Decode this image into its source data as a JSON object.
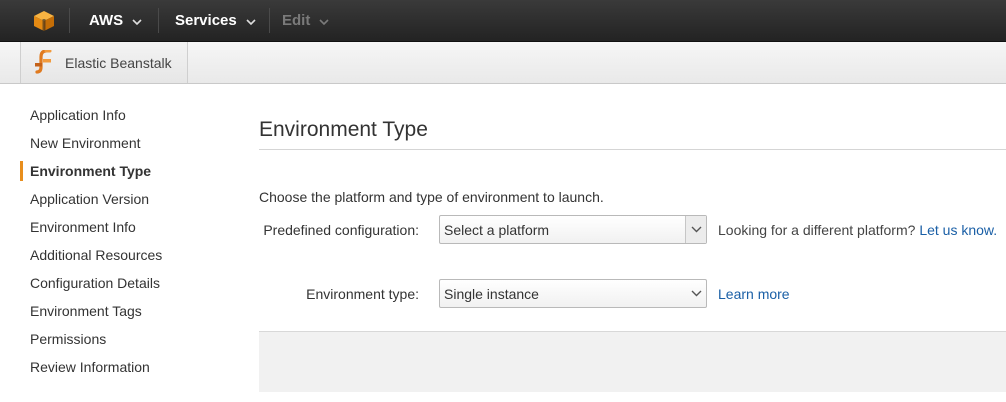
{
  "topnav": {
    "aws_label": "AWS",
    "services_label": "Services",
    "edit_label": "Edit"
  },
  "service": {
    "name": "Elastic Beanstalk"
  },
  "sidebar": {
    "items": [
      {
        "label": "Application Info"
      },
      {
        "label": "New Environment"
      },
      {
        "label": "Environment Type"
      },
      {
        "label": "Application Version"
      },
      {
        "label": "Environment Info"
      },
      {
        "label": "Additional Resources"
      },
      {
        "label": "Configuration Details"
      },
      {
        "label": "Environment Tags"
      },
      {
        "label": "Permissions"
      },
      {
        "label": "Review Information"
      }
    ],
    "active_index": 2
  },
  "main": {
    "title": "Environment Type",
    "intro": "Choose the platform and type of environment to launch.",
    "predefined": {
      "label": "Predefined configuration:",
      "value": "Select a platform",
      "hint_text": "Looking for a different platform?",
      "hint_link": "Let us know."
    },
    "envtype": {
      "label": "Environment type:",
      "value": "Single instance",
      "link": "Learn more"
    }
  },
  "colors": {
    "accent": "#e88e1d",
    "link": "#1a5fa6",
    "topbar": "#2b2b2b"
  }
}
